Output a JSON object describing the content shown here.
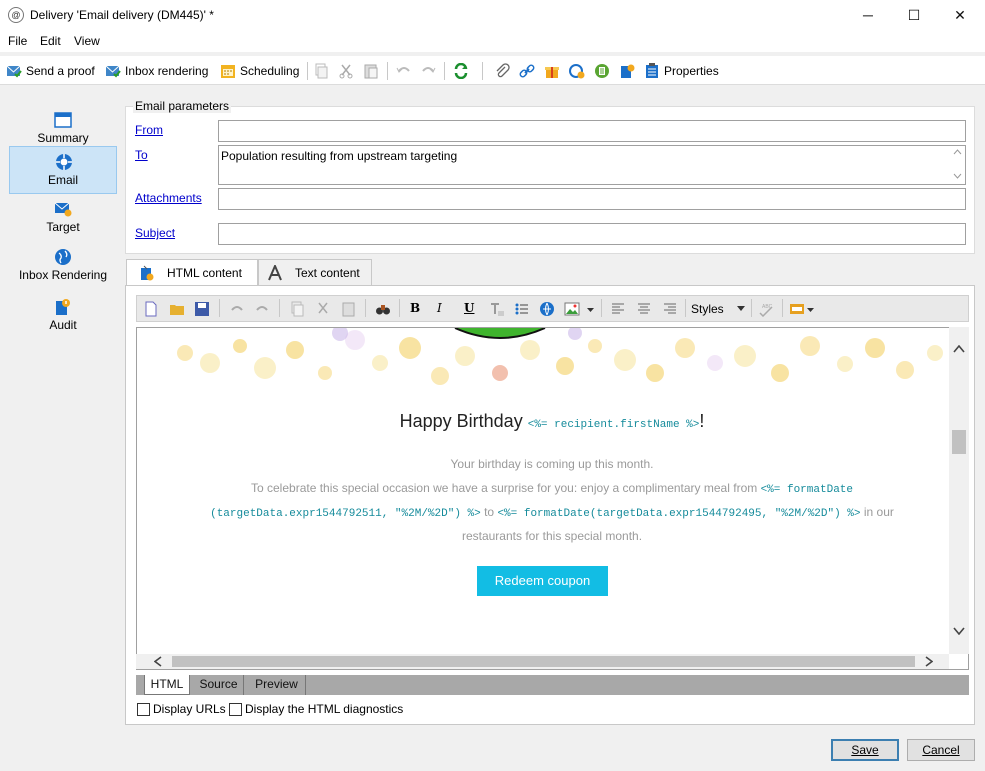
{
  "window": {
    "title": "Delivery 'Email delivery (DM445)' *",
    "minimize": "─",
    "maximize": "☐",
    "close": "✕"
  },
  "menu": [
    "File",
    "Edit",
    "View"
  ],
  "toolbar": {
    "send_proof": "Send a proof",
    "inbox_rendering": "Inbox rendering",
    "scheduling": "Scheduling",
    "properties": "Properties"
  },
  "nav": [
    {
      "label": "Summary",
      "icon": "summary-icon"
    },
    {
      "label": "Email",
      "icon": "email-icon",
      "selected": true
    },
    {
      "label": "Target",
      "icon": "target-icon"
    },
    {
      "label": "Inbox Rendering",
      "icon": "globe-icon"
    },
    {
      "label": "Audit",
      "icon": "audit-icon"
    }
  ],
  "params": {
    "legend": "Email parameters",
    "from_label": "From",
    "from_value": "",
    "to_label": "To",
    "to_value": "Population resulting from upstream targeting",
    "attachments_label": "Attachments",
    "attachments_value": "",
    "subject_label": "Subject",
    "subject_value": ""
  },
  "tabs": {
    "html": "HTML content",
    "text": "Text content"
  },
  "editor": {
    "styles_label": "Styles"
  },
  "email": {
    "heading_text": "Happy Birthday",
    "heading_code": "<%= recipient.firstName %>",
    "heading_end": "!",
    "line1": "Your birthday is coming up this month.",
    "line2_text": "To celebrate this special occasion we have a surprise for you: enjoy a complimentary meal from",
    "code1": "<%= formatDate",
    "code2": "(targetData.expr1544792511, \"%2M/%2D\") %>",
    "to_word": "to",
    "code3": "<%= formatDate(targetData.expr1544792495, \"%2M/%2D\") %>",
    "line3_end": "in our",
    "line4": "restaurants for this special month.",
    "button": "Redeem coupon"
  },
  "bottom_tabs": [
    "HTML",
    "Source",
    "Preview"
  ],
  "options": {
    "display_urls": "Display URLs",
    "html_diag": "Display the HTML diagnostics"
  },
  "buttons": {
    "save": "Save",
    "cancel": "Cancel"
  },
  "colors": {
    "accent": "#12bde4",
    "selected_nav": "#cce4f7",
    "code": "#158b9b"
  }
}
